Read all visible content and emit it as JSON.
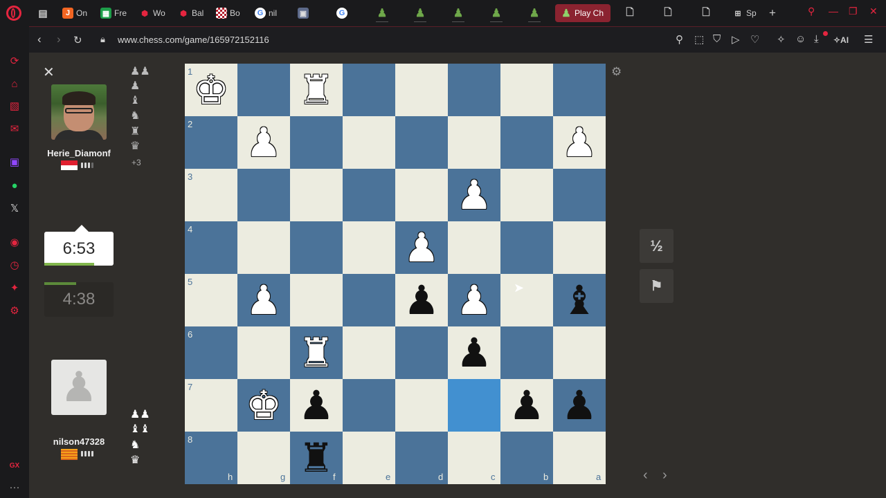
{
  "tabs": [
    {
      "label": "On",
      "icon": "jira-icon",
      "color": "#f26522"
    },
    {
      "label": "Fre",
      "icon": "sheet-icon",
      "color": "#1e9e4a"
    },
    {
      "label": "Wo",
      "icon": "hex-icon",
      "color": "#e4253f"
    },
    {
      "label": "Bal",
      "icon": "hex-icon",
      "color": "#e4253f"
    },
    {
      "label": "Bo",
      "icon": "checker-icon",
      "color": "#b21d2b"
    },
    {
      "label": "nil",
      "icon": "google-icon",
      "color": "#ffffff"
    }
  ],
  "active_tab": {
    "label": "Play Ch"
  },
  "last_tab": {
    "label": "Sp"
  },
  "address": {
    "url": "www.chess.com/game/165972152116"
  },
  "top_player": {
    "name": "Herie_Diamonf",
    "clock": "4:38",
    "captured_more": "+3"
  },
  "bottom_player": {
    "name": "nilson47328",
    "clock": "6:53"
  },
  "clock_progress": {
    "active": 0.72,
    "idle": 0.46
  },
  "board": {
    "files": [
      "h",
      "g",
      "f",
      "e",
      "d",
      "c",
      "b",
      "a"
    ],
    "ranks": [
      "1",
      "2",
      "3",
      "4",
      "5",
      "6",
      "7",
      "8"
    ],
    "light_color": "#ecece0",
    "dark_color": "#4b7399",
    "highlight_square": "c7",
    "pieces": [
      {
        "sq": "h1",
        "glyph": "♚",
        "side": "w",
        "name": "white-king"
      },
      {
        "sq": "f1",
        "glyph": "♜",
        "side": "w",
        "name": "white-rook"
      },
      {
        "sq": "g2",
        "glyph": "♟",
        "side": "w",
        "name": "white-pawn"
      },
      {
        "sq": "a2",
        "glyph": "♟",
        "side": "w",
        "name": "white-pawn"
      },
      {
        "sq": "c3",
        "glyph": "♟",
        "side": "w",
        "name": "white-pawn"
      },
      {
        "sq": "d4",
        "glyph": "♟",
        "side": "w",
        "name": "white-pawn"
      },
      {
        "sq": "g5",
        "glyph": "♟",
        "side": "w",
        "name": "white-pawn"
      },
      {
        "sq": "d5",
        "glyph": "♟",
        "side": "b",
        "name": "black-pawn"
      },
      {
        "sq": "c5",
        "glyph": "♟",
        "side": "w",
        "name": "white-pawn"
      },
      {
        "sq": "a5",
        "glyph": "♝",
        "side": "b",
        "name": "black-bishop"
      },
      {
        "sq": "f6",
        "glyph": "♜",
        "side": "w",
        "name": "white-rook"
      },
      {
        "sq": "c6",
        "glyph": "♟",
        "side": "b",
        "name": "black-pawn"
      },
      {
        "sq": "g7",
        "glyph": "♚",
        "side": "w",
        "name": "white-king-piece"
      },
      {
        "sq": "f7",
        "glyph": "♟",
        "side": "b",
        "name": "black-pawn"
      },
      {
        "sq": "b7",
        "glyph": "♟",
        "side": "b",
        "name": "black-pawn"
      },
      {
        "sq": "a7",
        "glyph": "♟",
        "side": "b",
        "name": "black-pawn"
      },
      {
        "sq": "f8",
        "glyph": "♜",
        "side": "b",
        "name": "black-rook"
      }
    ]
  },
  "controls": {
    "draw_label": "½",
    "resign_icon": "flag-icon"
  }
}
